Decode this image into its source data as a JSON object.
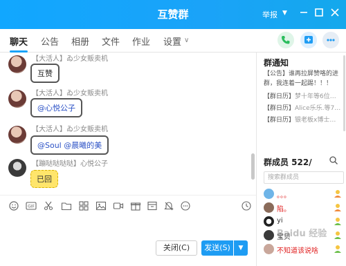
{
  "window": {
    "title": "互赞群",
    "report_label": "举报",
    "accent_color": "#1aa3f8"
  },
  "tabs": [
    {
      "label": "聊天",
      "active": true
    },
    {
      "label": "公告"
    },
    {
      "label": "相册"
    },
    {
      "label": "文件"
    },
    {
      "label": "作业"
    },
    {
      "label": "设置"
    }
  ],
  "messages": [
    {
      "sender": "【大活人】ゐ少女贩卖机",
      "text": "互赞"
    },
    {
      "sender": "【大活人】ゐ少女贩卖机",
      "text": "@心悦公子"
    },
    {
      "sender": "【大活人】ゐ少女贩卖机",
      "text": "@Soul  @晨曦的美"
    },
    {
      "sender": "【蹦哒哒哒哒】心悦公子",
      "text": "已回"
    }
  ],
  "buttons": {
    "close": "关闭(C)",
    "send": "发送(S)"
  },
  "notice": {
    "title": "群通知",
    "announcement_tag": "【公告】",
    "announcement_text": "谁再拉屏赞咯的进群，我连着一起踢！！！",
    "calendar_items": [
      {
        "tag": "【群日历】",
        "text": "梦十年等6位…"
      },
      {
        "tag": "【群日历】",
        "text": "Alice乐乐.等7…"
      },
      {
        "tag": "【群日历】",
        "text": "银老板x博士…"
      }
    ]
  },
  "members": {
    "title": "群成员 522/",
    "search_placeholder": "搜索群成员",
    "list": [
      {
        "name": "。。。",
        "color": "#e02020"
      },
      {
        "name": "陷。",
        "color": "#e02020"
      },
      {
        "name": "yi",
        "color": "#333333"
      },
      {
        "name": "宝贝",
        "color": "#333333"
      },
      {
        "name": "不知道该说啥",
        "color": "#e02020"
      }
    ]
  },
  "watermark": "Baidu 经验"
}
